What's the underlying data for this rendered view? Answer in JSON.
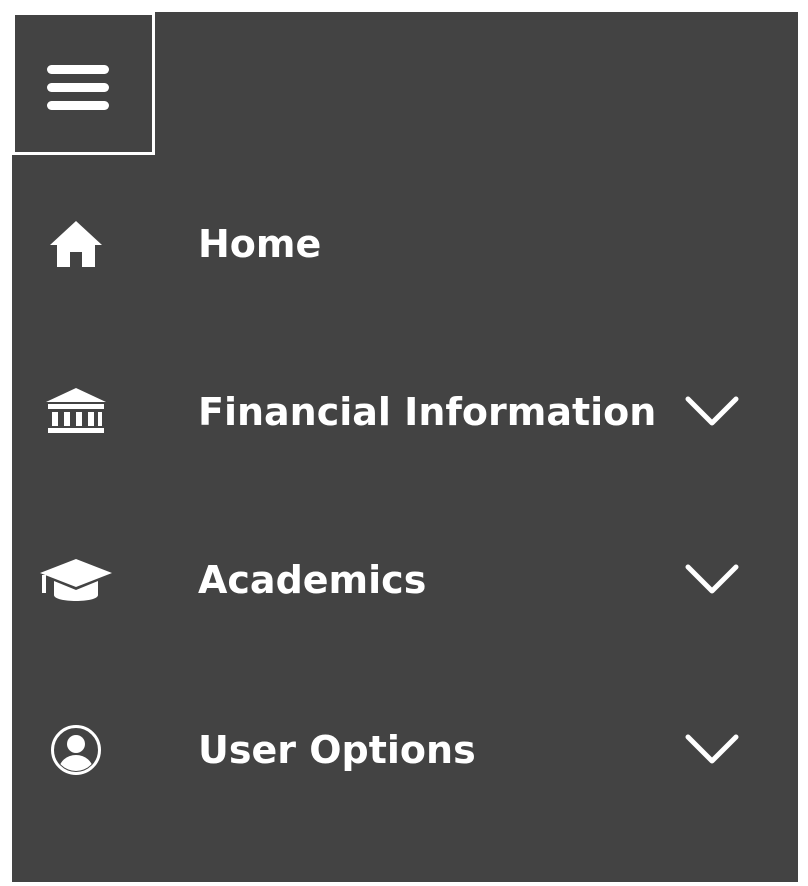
{
  "nav": {
    "items": [
      {
        "label": "Home",
        "icon": "home-icon",
        "expandable": false
      },
      {
        "label": "Financial Information",
        "icon": "bank-icon",
        "expandable": true
      },
      {
        "label": "Academics",
        "icon": "graduation-cap-icon",
        "expandable": true
      },
      {
        "label": "User Options",
        "icon": "user-circle-icon",
        "expandable": true
      }
    ]
  },
  "colors": {
    "panel_background": "#434343",
    "foreground": "#ffffff"
  }
}
